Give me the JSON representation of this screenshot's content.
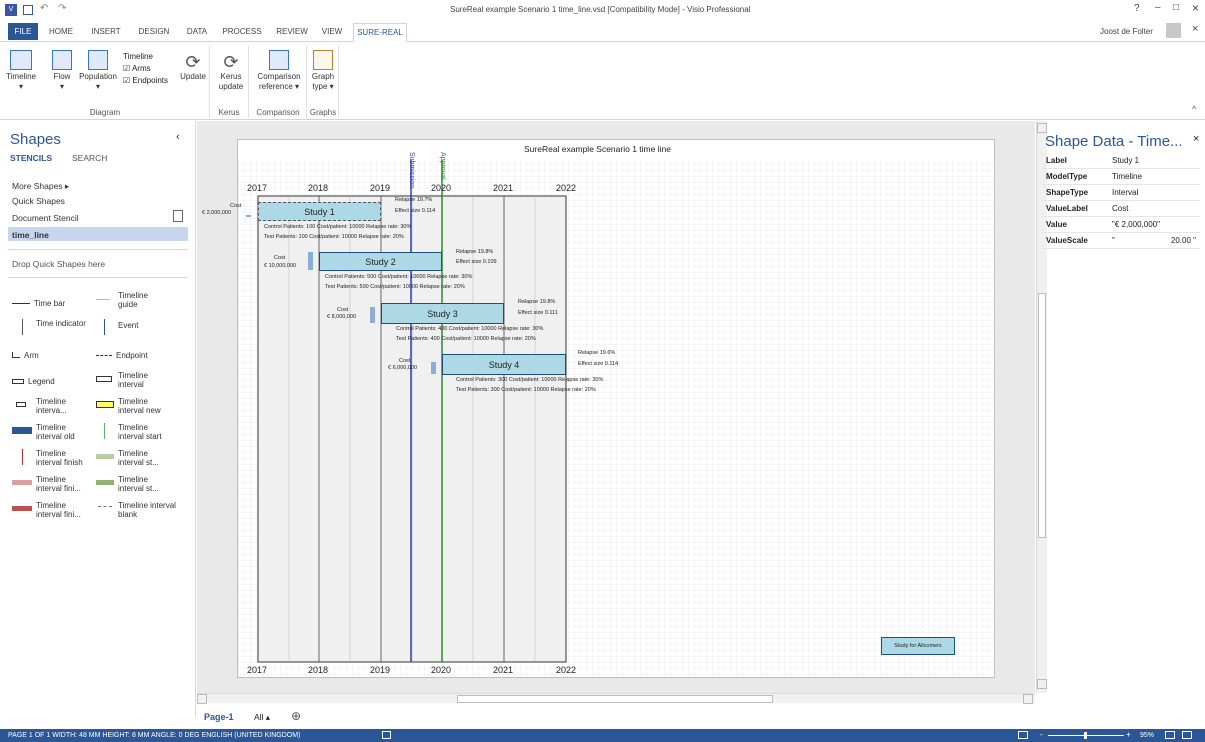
{
  "titlebar": {
    "title": "SureReal example Scenario 1 time_line.vsd  [Compatibility Mode] - Visio Professional",
    "help": "?",
    "minimize": "–",
    "restore": "□",
    "close": "×"
  },
  "tabs": [
    {
      "label": "FILE"
    },
    {
      "label": "HOME"
    },
    {
      "label": "INSERT"
    },
    {
      "label": "DESIGN"
    },
    {
      "label": "DATA"
    },
    {
      "label": "PROCESS"
    },
    {
      "label": "REVIEW"
    },
    {
      "label": "VIEW"
    },
    {
      "label": "SURE-REAL"
    }
  ],
  "user": {
    "name": "Joost de Folter",
    "close": "×"
  },
  "ribbon": {
    "timeline": "Timeline",
    "flow": "Flow",
    "population": "Population",
    "timeline2": "Timeline",
    "arms": "Arms",
    "endpoints": "Endpoints",
    "update": "Update",
    "kerus_update_1": "Kerus",
    "kerus_update_2": "update",
    "comparison_1": "Comparison",
    "comparison_2": "reference ▾",
    "graph_1": "Graph",
    "graph_2": "type ▾",
    "group_diagram": "Diagram",
    "group_kerus": "Kerus",
    "group_comparison": "Comparison",
    "group_graphs": "Graphs",
    "collapse": "^"
  },
  "shapes": {
    "title": "Shapes",
    "stencils": "STENCILS",
    "search": "SEARCH",
    "more": "More Shapes  ▸",
    "quick": "Quick Shapes",
    "doc_stencil": "Document Stencil",
    "time_line": "time_line",
    "drop": "Drop Quick Shapes here",
    "collapse": "‹",
    "items": [
      "Time bar",
      "Timeline guide",
      "Time indicator",
      "Event",
      "Arm",
      "Endpoint",
      "Legend",
      "Timeline interval",
      "Timeline interva...",
      "Timeline interval new",
      "Timeline interval old",
      "Timeline interval start",
      "Timeline interval finish",
      "Timeline interval st...",
      "Timeline interval fini...",
      "Timeline interval st...",
      "Timeline interval fini...",
      "Timeline interval blank"
    ]
  },
  "diagram": {
    "title": "SureReal example Scenario 1 time line",
    "years": [
      "2017",
      "2018",
      "2019",
      "2020",
      "2021",
      "2022"
    ],
    "submission": "Submission",
    "approval": "Approval",
    "allcomers": "Study for Allcomers",
    "studies": [
      {
        "name": "Study 1",
        "cost_label": "Cost",
        "cost": "€ 2,000,000",
        "relapse": "Relapse 19.7%",
        "effect": "Effect size 0.114",
        "control": "Control Patients: 100 Cost/patient: 10000 Relapse rate: 30%",
        "test": "Test Patients: 100 Cost/patient: 10000 Relapse rate: 20%"
      },
      {
        "name": "Study 2",
        "cost_label": "Cost",
        "cost": "€ 10,000,000",
        "relapse": "Relapse 19.8%",
        "effect": "Effect size 0.109",
        "control": "Control Patients: 500 Cost/patient: 10000 Relapse rate: 30%",
        "test": "Test Patients: 500 Cost/patient: 10000 Relapse rate: 20%"
      },
      {
        "name": "Study 3",
        "cost_label": "Cost",
        "cost": "€ 8,000,000",
        "relapse": "Relapse 19.8%",
        "effect": "Effect size 0.111",
        "control": "Control Patients: 400 Cost/patient: 10000 Relapse rate: 30%",
        "test": "Test Patients: 400 Cost/patient: 10000 Relapse rate: 20%"
      },
      {
        "name": "Study 4",
        "cost_label": "Cost",
        "cost": "€ 6,000,000",
        "relapse": "Relapse 19.6%",
        "effect": "Effect size 0.114",
        "control": "Control Patients: 300 Cost/patient: 10000 Relapse rate: 30%",
        "test": "Test Patients: 300 Cost/patient: 10000 Relapse rate: 20%"
      }
    ]
  },
  "shape_data": {
    "title": "Shape Data - Time...",
    "close": "×",
    "rows": [
      {
        "k": "Label",
        "v": "Study 1"
      },
      {
        "k": "ModelType",
        "v": "Timeline"
      },
      {
        "k": "ShapeType",
        "v": "Interval"
      },
      {
        "k": "ValueLabel",
        "v": "Cost"
      },
      {
        "k": "Value",
        "v": "\"€ 2,000,000\""
      },
      {
        "k": "ValueScale",
        "v": "\"",
        "v2": "20.00 \""
      }
    ]
  },
  "pages": {
    "page1": "Page-1",
    "all": "All ▴",
    "add": "⊕"
  },
  "status": {
    "left": "PAGE 1 OF 1    WIDTH: 48 MM    HEIGHT: 8 MM    ANGLE: 0 DEG    ENGLISH (UNITED KINGDOM)",
    "zoom": "95%"
  }
}
